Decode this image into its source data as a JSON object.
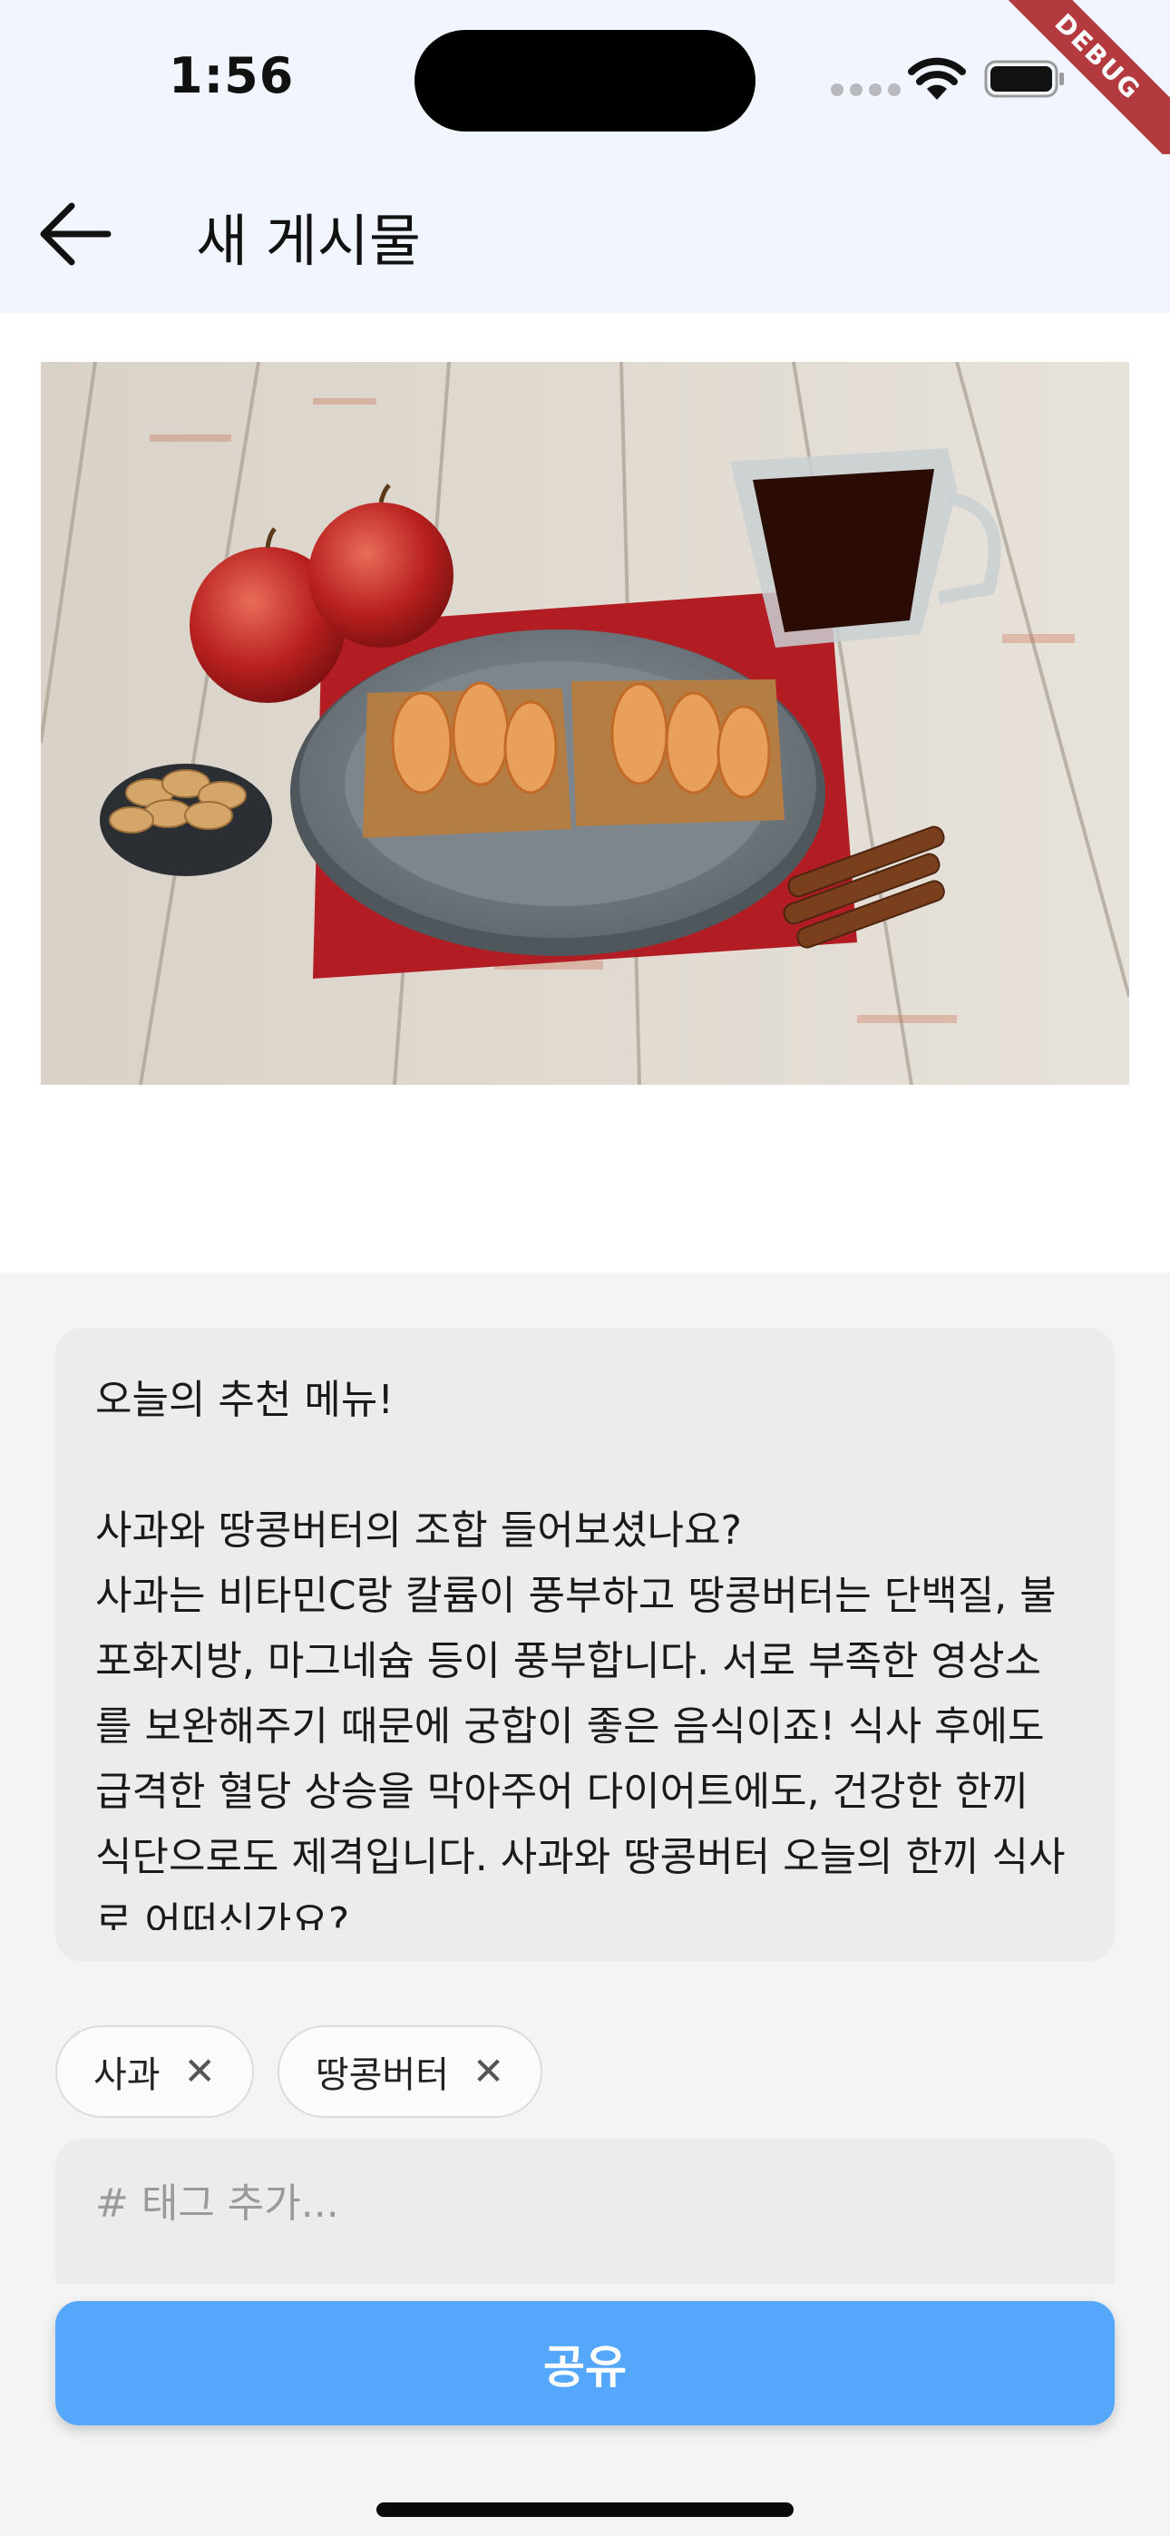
{
  "status_bar": {
    "time": "1:56",
    "debug_label": "DEBUG"
  },
  "app_bar": {
    "title": "새 게시물",
    "back_icon": "arrow-left-icon"
  },
  "post": {
    "photo_icon": "food-photo",
    "caption": "오늘의 추천 메뉴!\n\n사과와 땅콩버터의 조합 들어보셨나요?\n사과는 비타민C랑 칼륨이 풍부하고 땅콩버터는 단백질, 불포화지방, 마그네슘 등이 풍부합니다. 서로 부족한 영상소를 보완해주기 때문에 궁합이 좋은 음식이죠! 식사 후에도 급격한 혈당 상승을 막아주어 다이어트에도, 건강한 한끼 식단으로도 제격입니다. 사과와 땅콩버터 오늘의 한끼 식사로 어떠신가요?"
  },
  "tags": [
    {
      "label": "사과",
      "remove_icon": "close-icon"
    },
    {
      "label": "땅콩버터",
      "remove_icon": "close-icon"
    }
  ],
  "tag_input": {
    "value": "",
    "placeholder": "# 태그 추가..."
  },
  "share_button": {
    "label": "공유"
  },
  "colors": {
    "app_bar_bg": "#f0f5fe",
    "accent": "#55a7fb",
    "debug_ribbon": "#b33a3f"
  }
}
